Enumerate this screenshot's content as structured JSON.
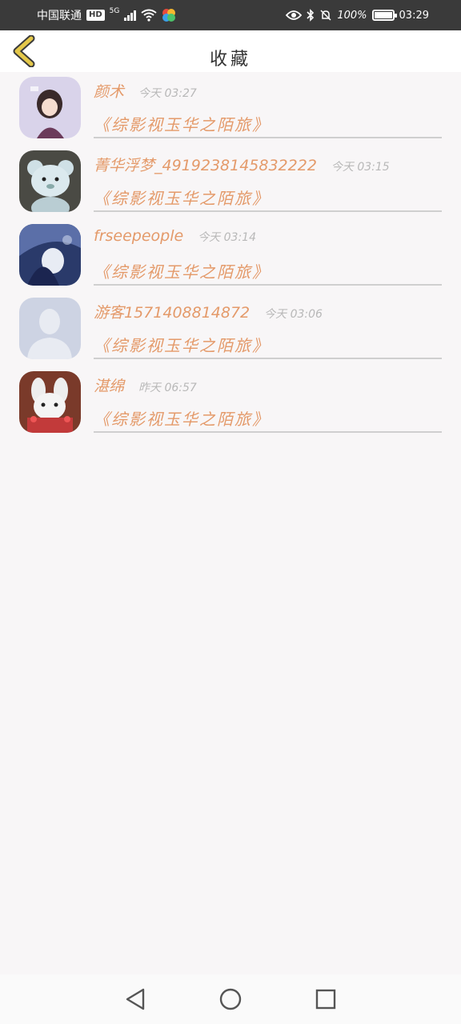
{
  "status_bar": {
    "carrier": "中国联通",
    "hd": "HD",
    "network": "5G",
    "battery_pct": "100%",
    "time": "03:29"
  },
  "header": {
    "title": "收藏",
    "back_icon": "chevron-left-icon",
    "accent_color": "#e4c84a"
  },
  "favorites": [
    {
      "username": "颜术",
      "time": "今天 03:27",
      "book": "《综影视玉华之陌旅》",
      "avatar": "anime-girl-avatar"
    },
    {
      "username": "菁华浮梦_4919238145832222",
      "time": "今天 03:15",
      "book": "《综影视玉华之陌旅》",
      "avatar": "teddy-bear-avatar"
    },
    {
      "username": "frseepeople",
      "time": "今天 03:14",
      "book": "《综影视玉华之陌旅》",
      "avatar": "anime-art-avatar"
    },
    {
      "username": "游客1571408814872",
      "time": "今天 03:06",
      "book": "《综影视玉华之陌旅》",
      "avatar": "default-person-avatar"
    },
    {
      "username": "湛绵",
      "time": "昨天 06:57",
      "book": "《综影视玉华之陌旅》",
      "avatar": "bunny-avatar"
    }
  ],
  "colors": {
    "name_color": "#e49a6a",
    "time_color": "#b8b8b8",
    "divider": "#cfcfcf",
    "background": "#f8f6f7"
  }
}
